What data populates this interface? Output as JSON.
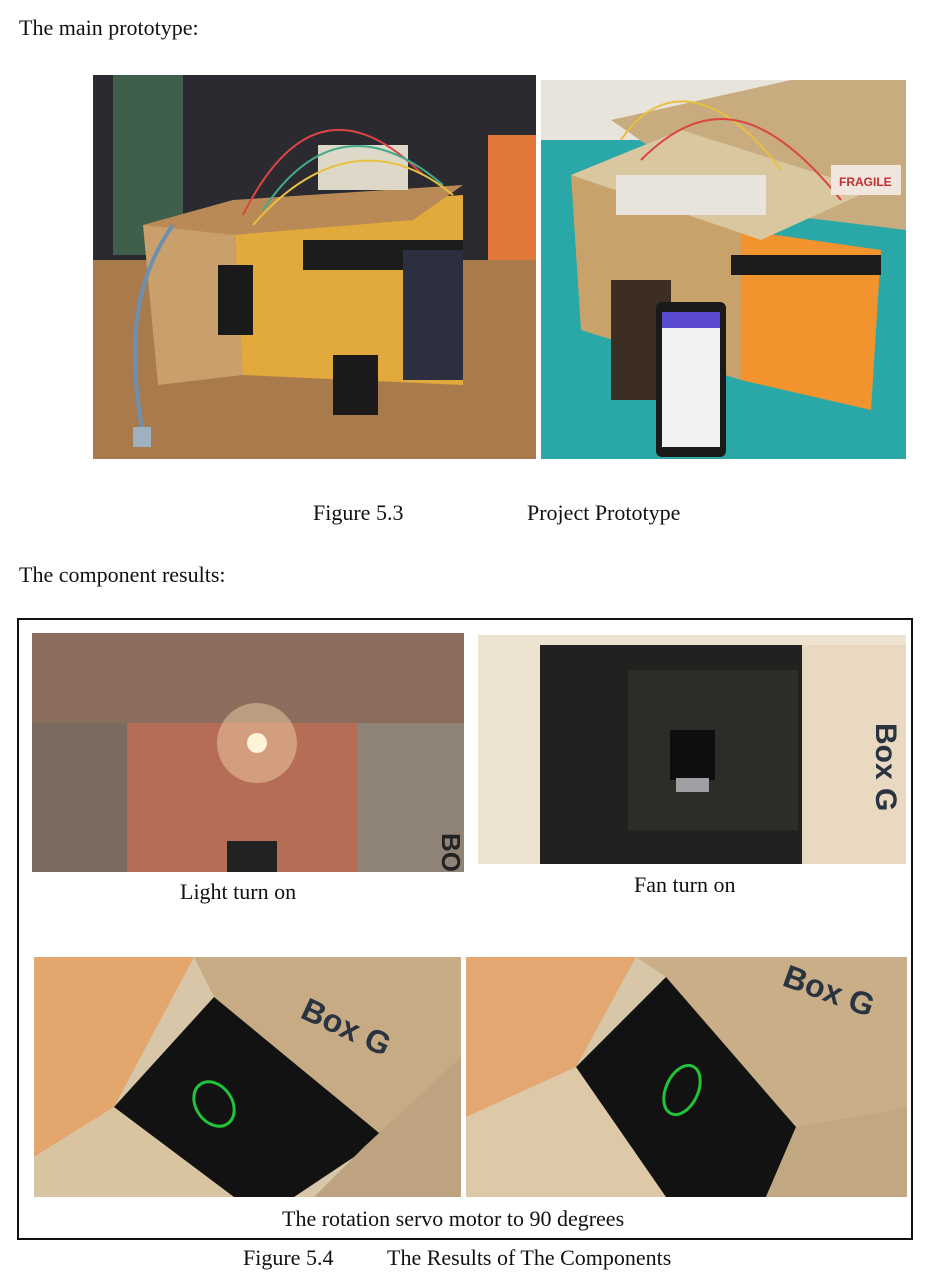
{
  "section_intro_prototype": "The main prototype:",
  "figure_5_3": {
    "number": "Figure 5.3",
    "caption": "Project Prototype"
  },
  "section_intro_components": "The component results:",
  "panels": {
    "light": {
      "caption": "Light turn on"
    },
    "fan": {
      "caption": "Fan turn on"
    },
    "servo": {
      "caption": "The rotation servo motor to 90 degrees"
    }
  },
  "box_labels": {
    "box_g": "Box G",
    "box_partial": "BO",
    "fragile": "FRAGILE"
  },
  "figure_5_4": {
    "number": "Figure 5.4",
    "caption": "The Results of The Components"
  }
}
